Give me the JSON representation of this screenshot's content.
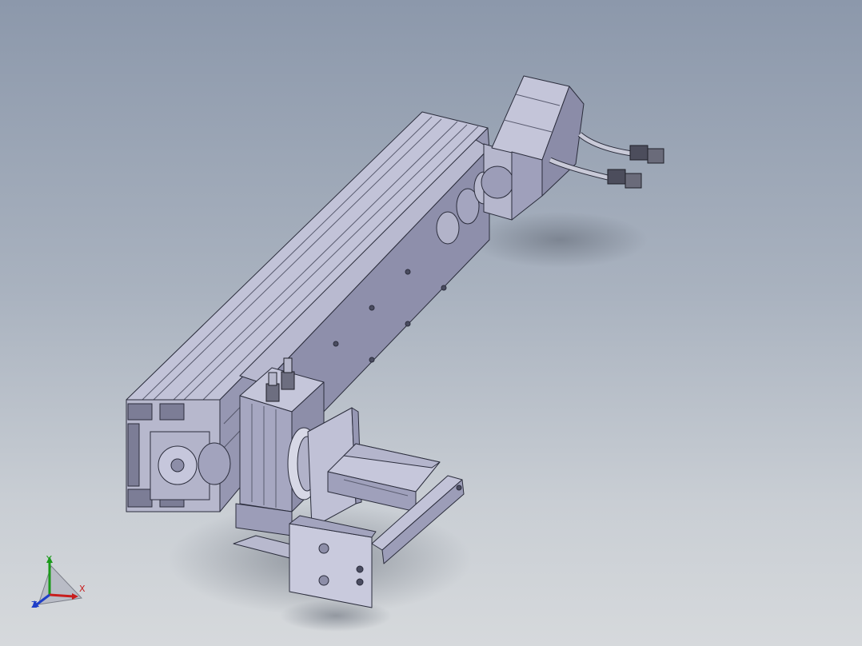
{
  "viewport": {
    "background_top": "#8c98ab",
    "background_bottom": "#d6d9dc",
    "model_color": "#a9aac3"
  },
  "triad": {
    "x_label": "X",
    "y_label": "Y",
    "z_label": "Z",
    "x_color": "#c81d1d",
    "y_color": "#1a9a1a",
    "z_color": "#1f3fc8"
  }
}
